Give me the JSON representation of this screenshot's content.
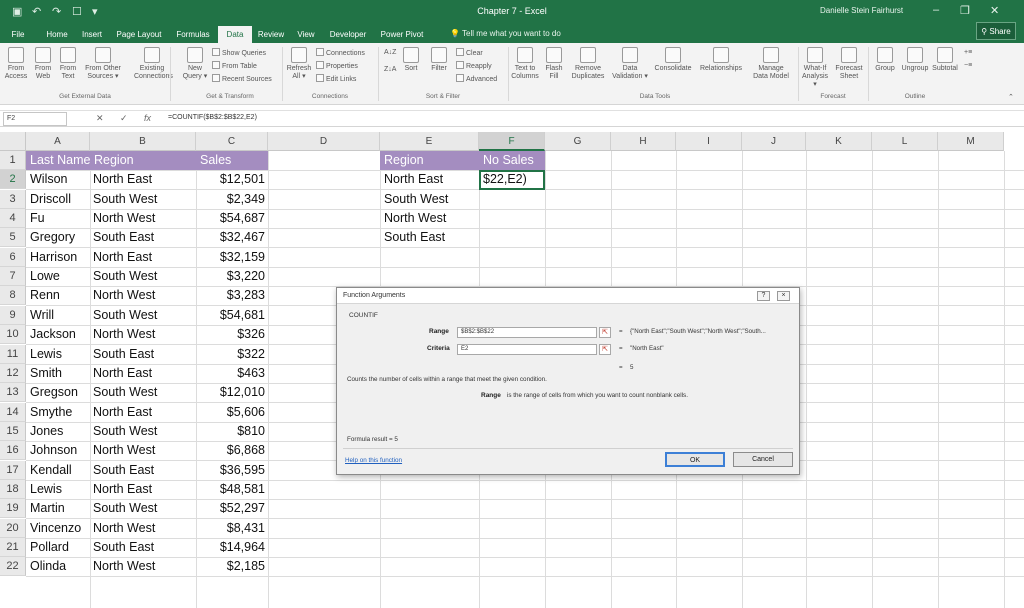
{
  "window": {
    "title": "Chapter 7 - Excel",
    "user": "Danielle Stein Fairhurst"
  },
  "ribbon_tabs": [
    "File",
    "Home",
    "Insert",
    "Page Layout",
    "Formulas",
    "Data",
    "Review",
    "View",
    "Developer",
    "Power Pivot"
  ],
  "active_tab": "Data",
  "tell_me": "Tell me what you want to do",
  "share_label": "Share",
  "ribbon": {
    "get_external": {
      "label": "Get External Data",
      "buttons": [
        [
          "From",
          "Access"
        ],
        [
          "From",
          "Web"
        ],
        [
          "From",
          "Text"
        ],
        [
          "From Other",
          "Sources ▾"
        ],
        [
          "Existing",
          "Connections"
        ]
      ]
    },
    "get_transform": {
      "label": "Get & Transform",
      "new_query": [
        "New",
        "Query ▾"
      ],
      "small": [
        "Show Queries",
        "From Table",
        "Recent Sources"
      ]
    },
    "connections": {
      "label": "Connections",
      "refresh": [
        "Refresh",
        "All ▾"
      ],
      "small": [
        "Connections",
        "Properties",
        "Edit Links"
      ]
    },
    "sort_filter": {
      "label": "Sort & Filter",
      "sort": "Sort",
      "filter": "Filter",
      "small": [
        "Clear",
        "Reapply",
        "Advanced"
      ]
    },
    "data_tools": {
      "label": "Data Tools",
      "buttons": [
        [
          "Text to",
          "Columns"
        ],
        [
          "Flash",
          "Fill"
        ],
        [
          "Remove",
          "Duplicates"
        ],
        [
          "Data",
          "Validation ▾"
        ],
        [
          "Consolidate",
          ""
        ],
        [
          "Relationships",
          ""
        ],
        [
          "Manage",
          "Data Model"
        ]
      ]
    },
    "forecast": {
      "label": "Forecast",
      "buttons": [
        [
          "What-If",
          "Analysis ▾"
        ],
        [
          "Forecast",
          "Sheet"
        ]
      ]
    },
    "outline": {
      "label": "Outline",
      "buttons": [
        "Group",
        "Ungroup",
        "Subtotal"
      ]
    }
  },
  "formula_bar": {
    "name_box": "F2",
    "formula": "=COUNTIF($B$2:$B$22,E2)"
  },
  "columns": [
    "A",
    "B",
    "C",
    "D",
    "E",
    "F",
    "G",
    "H",
    "I",
    "J",
    "K",
    "L",
    "M"
  ],
  "selected_column": "F",
  "selected_row": "2",
  "rows": [
    "1",
    "2",
    "3",
    "4",
    "5",
    "6",
    "7",
    "8",
    "9",
    "10",
    "11",
    "12",
    "13",
    "14",
    "15",
    "16",
    "17",
    "18",
    "19",
    "20",
    "21",
    "22"
  ],
  "table": {
    "headers": [
      "Last Name",
      "Region",
      "Sales"
    ],
    "data": [
      [
        "Wilson",
        "North East",
        "$12,501"
      ],
      [
        "Driscoll",
        "South West",
        "$2,349"
      ],
      [
        "Fu",
        "North West",
        "$54,687"
      ],
      [
        "Gregory",
        "South East",
        "$32,467"
      ],
      [
        "Harrison",
        "North East",
        "$32,159"
      ],
      [
        "Lowe",
        "South West",
        "$3,220"
      ],
      [
        "Renn",
        "North West",
        "$3,283"
      ],
      [
        "Wrill",
        "South West",
        "$54,681"
      ],
      [
        "Jackson",
        "North West",
        "$326"
      ],
      [
        "Lewis",
        "South East",
        "$322"
      ],
      [
        "Smith",
        "North East",
        "$463"
      ],
      [
        "Gregson",
        "South West",
        "$12,010"
      ],
      [
        "Smythe",
        "North East",
        "$5,606"
      ],
      [
        "Jones",
        "South West",
        "$810"
      ],
      [
        "Johnson",
        "North West",
        "$6,868"
      ],
      [
        "Kendall",
        "South East",
        "$36,595"
      ],
      [
        "Lewis",
        "North East",
        "$48,581"
      ],
      [
        "Martin",
        "South West",
        "$52,297"
      ],
      [
        "Vincenzo",
        "North West",
        "$8,431"
      ],
      [
        "Pollard",
        "South East",
        "$14,964"
      ],
      [
        "Olinda",
        "North West",
        "$2,185"
      ]
    ]
  },
  "summary": {
    "headers": [
      "Region",
      "No Sales"
    ],
    "regions": [
      "North East",
      "South West",
      "North West",
      "South East"
    ],
    "f2_edit": "$22,E2)"
  },
  "dialog": {
    "title": "Function Arguments",
    "function": "COUNTIF",
    "range_label": "Range",
    "range_value": "$B$2:$B$22",
    "range_result": "{\"North East\";\"South West\";\"North West\";\"South...",
    "criteria_label": "Criteria",
    "criteria_value": "E2",
    "criteria_result": "\"North East\"",
    "eq_result": "5",
    "description": "Counts the number of cells within a range that meet the given condition.",
    "arg_name": "Range",
    "arg_desc": "is the range of cells from which you want to count nonblank cells.",
    "formula_result": "Formula result =  5",
    "help_link": "Help on this function",
    "ok": "OK",
    "cancel": "Cancel",
    "help_btn": "?",
    "close_btn": "×"
  },
  "colors": {
    "accent": "#217346",
    "header_fill": "#a48dc0"
  }
}
